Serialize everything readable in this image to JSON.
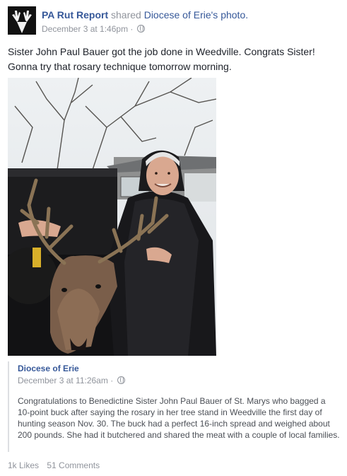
{
  "post": {
    "page_name": "PA Rut Report",
    "shared_text": "shared",
    "shared_target": "Diocese of Erie's photo.",
    "timestamp": "December 3 at 1:46pm",
    "separator": "·",
    "caption": "Sister John Paul Bauer got the job done in Weedville. Congrats Sister! Gonna try that rosary technique tomorrow morning."
  },
  "original": {
    "page_name": "Diocese of Erie",
    "timestamp": "December 3 at 11:26am",
    "separator": "·",
    "body": "Congratulations to Benedictine Sister John Paul Bauer of St. Marys who bagged a 10-point buck after saying the rosary in her tree stand in Weedville the first day of hunting season Nov. 30. The buck had a perfect 16-inch spread and weighed about 200 pounds. She had it butchered and shared the meat with a couple of local families."
  },
  "stats": {
    "likes": "1k Likes",
    "comments": "51 Comments"
  },
  "colors": {
    "link": "#365899",
    "meta": "#90949c",
    "text": "#1d2129"
  }
}
